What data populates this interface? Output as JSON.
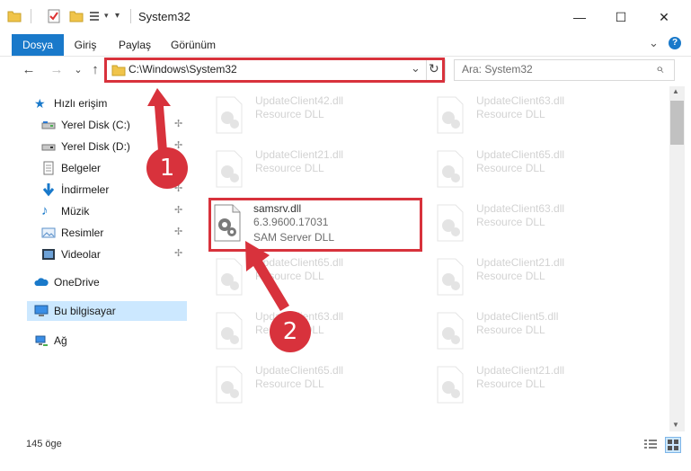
{
  "window": {
    "title": "System32",
    "minimize": "—",
    "maximize": "☐",
    "close": "✕"
  },
  "ribbon": {
    "tabs": [
      "Dosya",
      "Giriş",
      "Paylaş",
      "Görünüm"
    ],
    "collapse": "⌄",
    "help": "?"
  },
  "address": {
    "path": "C:\\Windows\\System32",
    "dropdown": "⌄",
    "refresh": "↻",
    "back": "←",
    "forward": "→",
    "recent": "⌄",
    "up": "↑"
  },
  "search": {
    "placeholder": "Ara: System32",
    "icon": "⌕"
  },
  "sidebar": {
    "items": [
      {
        "label": "Hızlı erişim",
        "icon": "star-icon",
        "pinned": false
      },
      {
        "label": "Yerel Disk (C:)",
        "icon": "drive-icon",
        "pinned": true
      },
      {
        "label": "Yerel Disk (D:)",
        "icon": "drive-icon",
        "pinned": true
      },
      {
        "label": "Belgeler",
        "icon": "documents-icon",
        "pinned": true
      },
      {
        "label": "İndirmeler",
        "icon": "downloads-icon",
        "pinned": true
      },
      {
        "label": "Müzik",
        "icon": "music-icon",
        "pinned": true
      },
      {
        "label": "Resimler",
        "icon": "pictures-icon",
        "pinned": true
      },
      {
        "label": "Videolar",
        "icon": "videos-icon",
        "pinned": true
      },
      {
        "label": "OneDrive",
        "icon": "cloud-icon",
        "pinned": false
      },
      {
        "label": "Bu bilgisayar",
        "icon": "computer-icon",
        "pinned": false,
        "selected": true
      },
      {
        "label": "Ağ",
        "icon": "network-icon",
        "pinned": false
      }
    ],
    "pin_glyph": "📌"
  },
  "files": {
    "left": [
      {
        "name": "UpdateClient42.dll",
        "type": "Resource DLL"
      },
      {
        "name": "UpdateClient21.dll",
        "type": "Resource DLL"
      },
      {
        "name": "samsrv.dll",
        "version": "6.3.9600.17031",
        "type": "SAM Server DLL",
        "highlighted": true
      },
      {
        "name": "UpdateClient65.dll",
        "type": "Resource DLL"
      },
      {
        "name": "UpdateClient63.dll",
        "type": "Resource DLL"
      },
      {
        "name": "UpdateClient65.dll",
        "type": "Resource DLL"
      }
    ],
    "right": [
      {
        "name": "UpdateClient63.dll",
        "type": "Resource DLL"
      },
      {
        "name": "UpdateClient65.dll",
        "type": "Resource DLL"
      },
      {
        "name": "UpdateClient63.dll",
        "type": "Resource DLL"
      },
      {
        "name": "UpdateClient21.dll",
        "type": "Resource DLL"
      },
      {
        "name": "UpdateClient5.dll",
        "type": "Resource DLL"
      },
      {
        "name": "UpdateClient21.dll",
        "type": "Resource DLL"
      }
    ]
  },
  "status": {
    "count": "145 öge"
  },
  "annotations": {
    "step1": "1",
    "step2": "2",
    "color": "#d8323c"
  },
  "colors": {
    "accent": "#1979ca",
    "selected_bg": "#cce8ff"
  }
}
